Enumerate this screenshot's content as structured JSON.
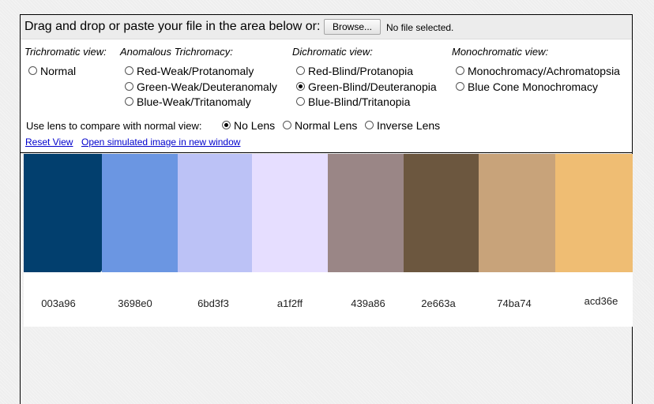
{
  "header": {
    "instruction": "Drag and drop or paste your file in the area below or:",
    "browse_label": "Browse...",
    "file_status": "No file selected."
  },
  "groups": {
    "trichromatic": {
      "title": "Trichromatic view:",
      "options": [
        "Normal"
      ]
    },
    "anomalous": {
      "title": "Anomalous Trichromacy:",
      "options": [
        "Red-Weak/Protanomaly",
        "Green-Weak/Deuteranomaly",
        "Blue-Weak/Tritanomaly"
      ]
    },
    "dichromatic": {
      "title": "Dichromatic view:",
      "options": [
        "Red-Blind/Protanopia",
        "Green-Blind/Deuteranopia",
        "Blue-Blind/Tritanopia"
      ]
    },
    "monochromatic": {
      "title": "Monochromatic view:",
      "options": [
        "Monochromacy/Achromatopsia",
        "Blue Cone Monochromacy"
      ]
    }
  },
  "selected_view": "Green-Blind/Deuteranopia",
  "lens": {
    "prompt": "Use lens to compare with normal view:",
    "options": [
      "No Lens",
      "Normal Lens",
      "Inverse Lens"
    ],
    "selected": "No Lens"
  },
  "links": {
    "reset": "Reset View",
    "open_new": "Open simulated image in new window"
  },
  "swatches": [
    {
      "label": "003a96",
      "color": "#023f6e"
    },
    {
      "label": "3698e0",
      "color": "#6b96e2"
    },
    {
      "label": "6bd3f3",
      "color": "#bcc2f6"
    },
    {
      "label": "a1f2ff",
      "color": "#e6deff"
    },
    {
      "label": "439a86",
      "color": "#9a8686"
    },
    {
      "label": "2e663a",
      "color": "#6c573f"
    },
    {
      "label": "74ba74",
      "color": "#c8a37a"
    },
    {
      "label": "acd36e",
      "color": "#efbd73"
    }
  ]
}
